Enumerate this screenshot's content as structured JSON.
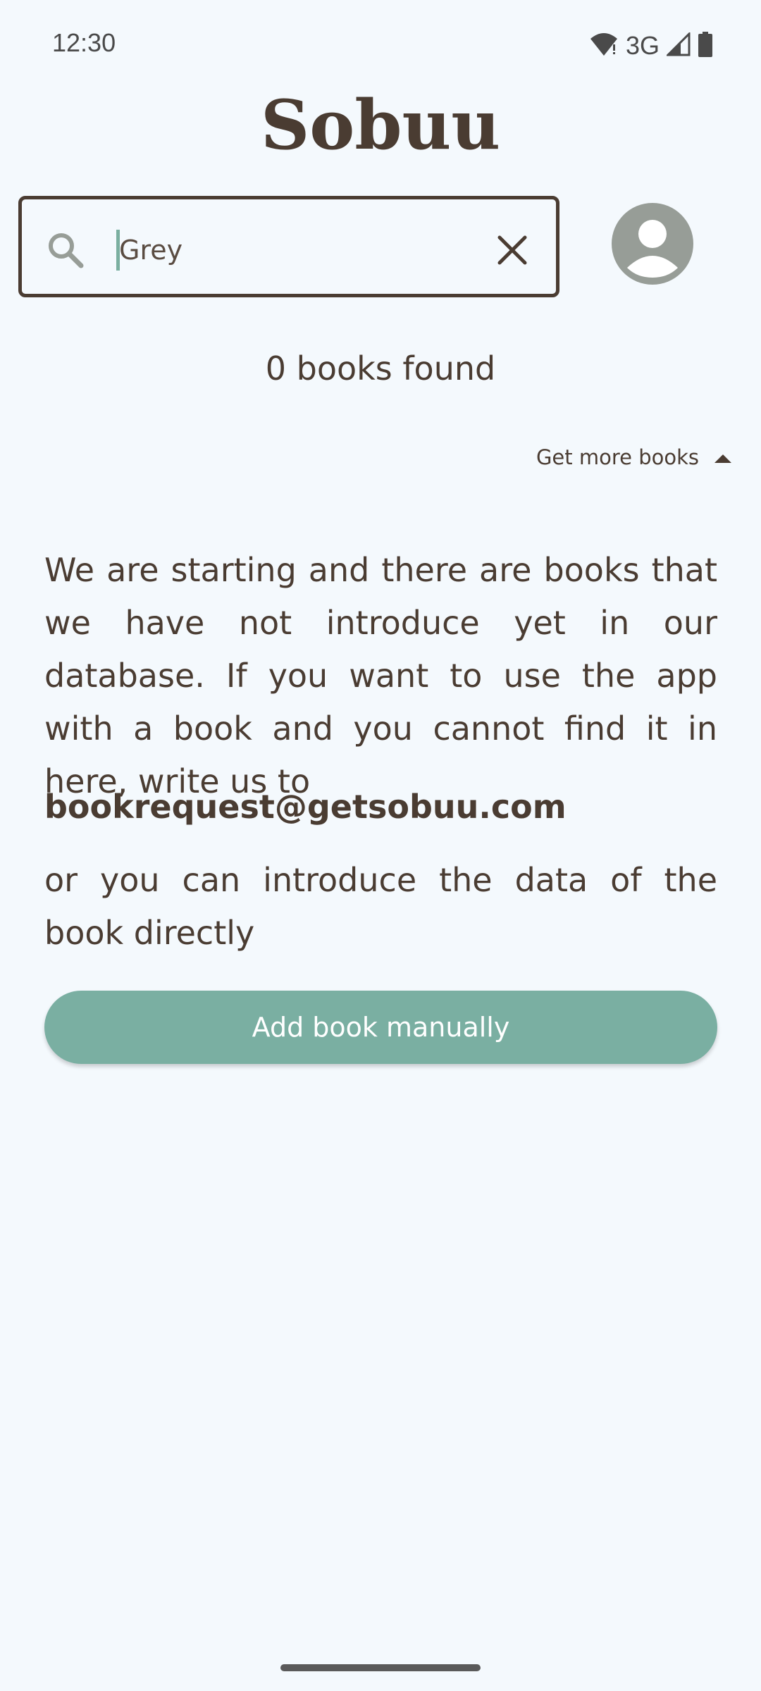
{
  "status_bar": {
    "time": "12:30",
    "network": "3G",
    "icons": [
      "wifi-icon",
      "signal-icon",
      "battery-icon"
    ]
  },
  "app": {
    "title": "Sobuu"
  },
  "search": {
    "value": "Grey",
    "icon": "search-icon",
    "clear_icon": "close-icon"
  },
  "profile": {
    "icon": "account-circle-icon"
  },
  "results": {
    "count_text": "0 books found"
  },
  "more_books": {
    "label": "Get more books",
    "icon": "triangle-up-icon"
  },
  "message": {
    "intro": "We are starting and there are books that we have not introduce yet in our database. If you want to use the app with a book and you cannot find it in here, write us to",
    "email": "bookrequest@getsobuu.com",
    "outro": "or you can introduce the data of the book directly"
  },
  "actions": {
    "add_manually_label": "Add book manually"
  },
  "colors": {
    "background": "#f4f9fd",
    "text": "#4a3c32",
    "accent": "#7aafa2",
    "avatar": "#979d97"
  }
}
